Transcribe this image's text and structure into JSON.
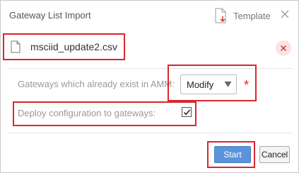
{
  "dialog": {
    "title": "Gateway List Import",
    "template_label": "Template",
    "icons": {
      "template": "file-download-icon",
      "close": "close-icon"
    }
  },
  "file": {
    "name": "msciid_update2.csv",
    "icons": {
      "file": "file-icon",
      "remove": "remove-icon"
    }
  },
  "form": {
    "existing_gateways": {
      "label": "Gateways which already exist in AMM:",
      "selected": "Modify",
      "required_marker": "*"
    },
    "deploy": {
      "label": "Deploy configuration to gateways:",
      "checked": true
    }
  },
  "buttons": {
    "start": "Start",
    "cancel": "Cancel"
  },
  "colors": {
    "highlight": "#d8272d",
    "primary_button": "#5b93db",
    "remove_bg": "#fbe3e3"
  }
}
